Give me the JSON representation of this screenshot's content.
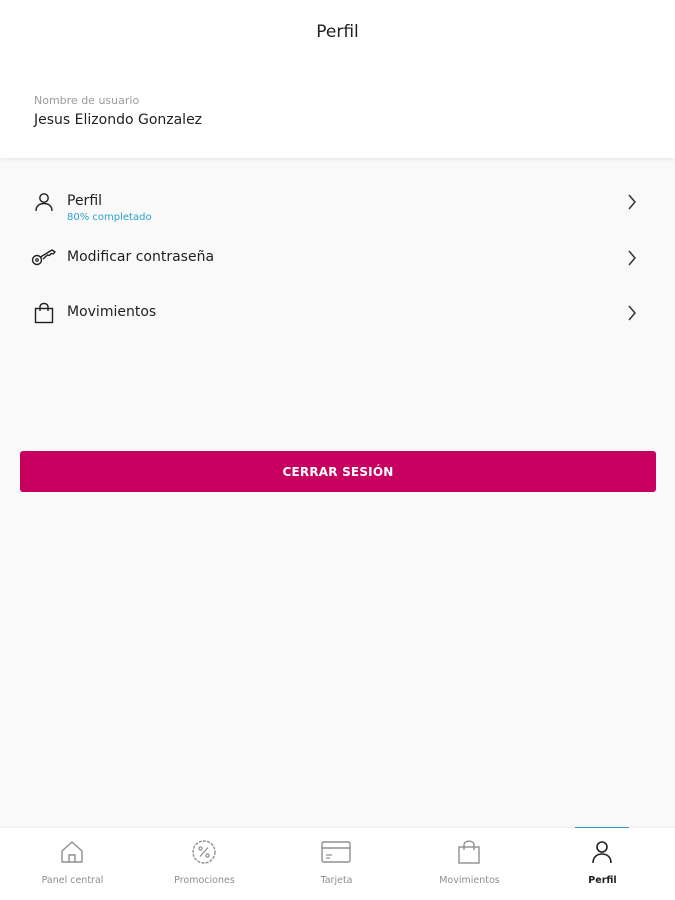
{
  "header": {
    "title": "Perfil",
    "username_label": "Nombre de usuario",
    "username_value": "Jesus Elizondo Gonzalez"
  },
  "menu": [
    {
      "label": "Perfil",
      "sublabel": "80% completado",
      "icon": "user-icon"
    },
    {
      "label": "Modificar contraseña",
      "icon": "key-icon"
    },
    {
      "label": "Movimientos",
      "icon": "shopping-bag-icon"
    }
  ],
  "logout_label": "CERRAR SESIÓN",
  "bottom_nav": [
    {
      "label": "Panel central",
      "icon": "home-icon"
    },
    {
      "label": "Promociones",
      "icon": "percent-badge-icon"
    },
    {
      "label": "Tarjeta",
      "icon": "card-icon"
    },
    {
      "label": "Movimientos",
      "icon": "shopping-bag-icon"
    },
    {
      "label": "Perfil",
      "icon": "user-icon",
      "active": true
    }
  ],
  "colors": {
    "accent": "#c8005f",
    "highlight": "#2aa3c9",
    "background": "#f9f9f9"
  }
}
